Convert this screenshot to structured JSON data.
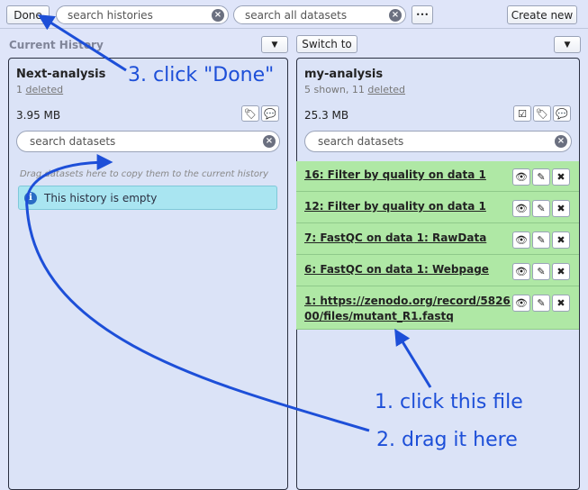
{
  "toolbar": {
    "done_label": "Done",
    "search_histories_placeholder": "search histories",
    "search_datasets_placeholder": "search all datasets",
    "more_label": "•••",
    "create_new_label": "Create new"
  },
  "section": {
    "current_history_label": "Current History",
    "switch_to_label": "Switch to"
  },
  "left_panel": {
    "name": "Next-analysis",
    "count_prefix": "1 ",
    "deleted_label": "deleted",
    "size": "3.95 MB",
    "search_placeholder": "search datasets",
    "drop_hint": "Drag datasets here to copy them to the current history",
    "empty_message": "This history is empty"
  },
  "right_panel": {
    "name": "my-analysis",
    "count_prefix": "5 shown, 11 ",
    "deleted_label": "deleted",
    "size": "25.3 MB",
    "search_placeholder": "search datasets",
    "datasets": [
      {
        "title": "16: Filter by quality on data 1"
      },
      {
        "title": "12: Filter by quality on data 1"
      },
      {
        "title": "7: FastQC on data 1: RawData"
      },
      {
        "title": "6: FastQC on data 1: Webpage"
      },
      {
        "title_line1": "1: https://zenodo.org/record/5826",
        "title_line2": "00/files/mutant_R1.fastq"
      }
    ]
  },
  "annotations": {
    "step3": "3. click \"Done\"",
    "step1": "1. click this file",
    "step2": "2. drag it here"
  },
  "colors": {
    "background": "#dfe5f9",
    "dataset_ok": "#afe8a5",
    "info_box": "#a9e5f1",
    "annotation": "#1d4fd8"
  }
}
